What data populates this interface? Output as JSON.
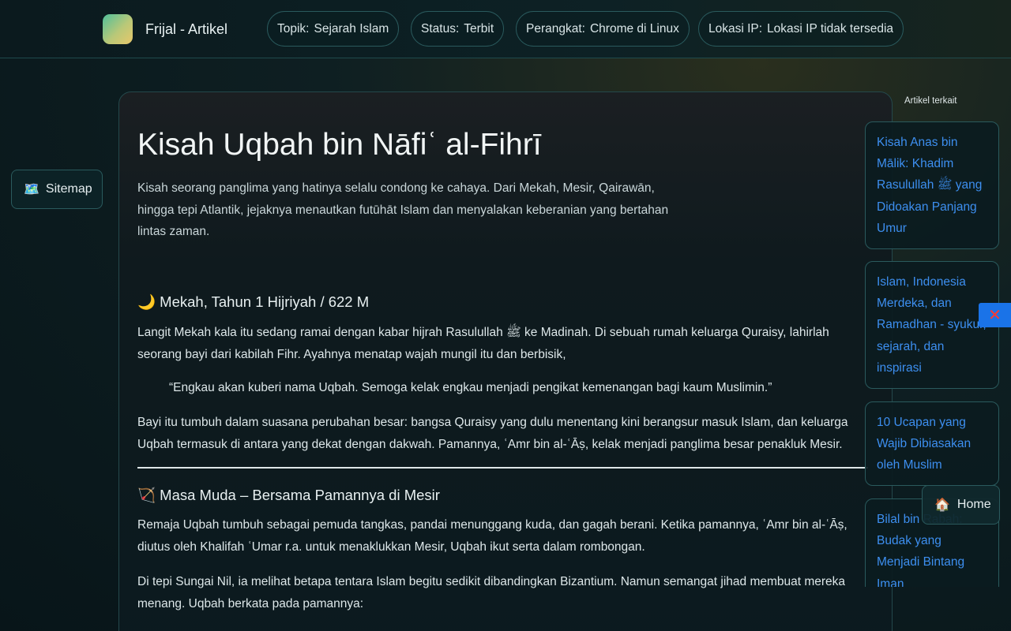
{
  "header": {
    "brand": "Frijal - Artikel",
    "pills": [
      {
        "key": "Topik:",
        "value": "Sejarah Islam"
      },
      {
        "key": "Status:",
        "value": "Terbit"
      },
      {
        "key": "Perangkat:",
        "value": "Chrome di Linux"
      },
      {
        "key": "Lokasi IP:",
        "value": "Lokasi IP tidak tersedia"
      }
    ]
  },
  "sitemap": {
    "icon": "🗺️",
    "label": "Sitemap"
  },
  "article": {
    "title": "Kisah Uqbah bin Nāfiʿ al-Fihrī",
    "lede": "Kisah seorang panglima yang hatinya selalu condong ke cahaya. Dari Mekah, Mesir, Qairawān, hingga tepi Atlantik, jejaknya menautkan futūhāt Islam dan menyalakan keberanian yang bertahan lintas zaman.",
    "section1": {
      "heading": "🌙 Mekah, Tahun 1 Hijriyah / 622 M",
      "p1": "Langit Mekah kala itu sedang ramai dengan kabar hijrah Rasulullah ﷺ ke Madinah. Di sebuah rumah keluarga Quraisy, lahirlah seorang bayi dari kabilah Fihr. Ayahnya menatap wajah mungil itu dan berbisik,",
      "quote": "“Engkau akan kuberi nama Uqbah. Semoga kelak engkau menjadi pengikat kemenangan bagi kaum Muslimin.”",
      "p2": "Bayi itu tumbuh dalam suasana perubahan besar: bangsa Quraisy yang dulu menentang kini berangsur masuk Islam, dan keluarga Uqbah termasuk di antara yang dekat dengan dakwah. Pamannya, ʿAmr bin al-ʿĀṣ, kelak menjadi panglima besar penakluk Mesir."
    },
    "section2": {
      "heading": "🏹 Masa Muda – Bersama Pamannya di Mesir",
      "p1": "Remaja Uqbah tumbuh sebagai pemuda tangkas, pandai menunggang kuda, dan gagah berani. Ketika pamannya, ʿAmr bin al-ʿĀṣ, diutus oleh Khalifah ʿUmar r.a. untuk menaklukkan Mesir, Uqbah ikut serta dalam rombongan.",
      "p2": "Di tepi Sungai Nil, ia melihat betapa tentara Islam begitu sedikit dibandingkan Bizantium. Namun semangat jihad membuat mereka menang. Uqbah berkata pada pamannya:"
    }
  },
  "related": {
    "label": "Artikel terkait",
    "items": [
      "Kisah Anas bin Mālik: Khadim Rasulullah ﷺ yang Didoakan Panjang Umur",
      "Islam, Indonesia Merdeka, dan Ramadhan - syukur, sejarah, dan inspirasi",
      "10 Ucapan yang Wajib Dibiasakan oleh Muslim",
      "Bilal bin Rabah: Budak yang Menjadi Bintang Iman"
    ]
  },
  "close": {
    "icon": "✕"
  },
  "home": {
    "icon": "🏠",
    "label": "Home"
  },
  "colors": {
    "link": "#3d8ff0",
    "close_bg": "#1a73e8",
    "close_x": "#ff3a30"
  }
}
